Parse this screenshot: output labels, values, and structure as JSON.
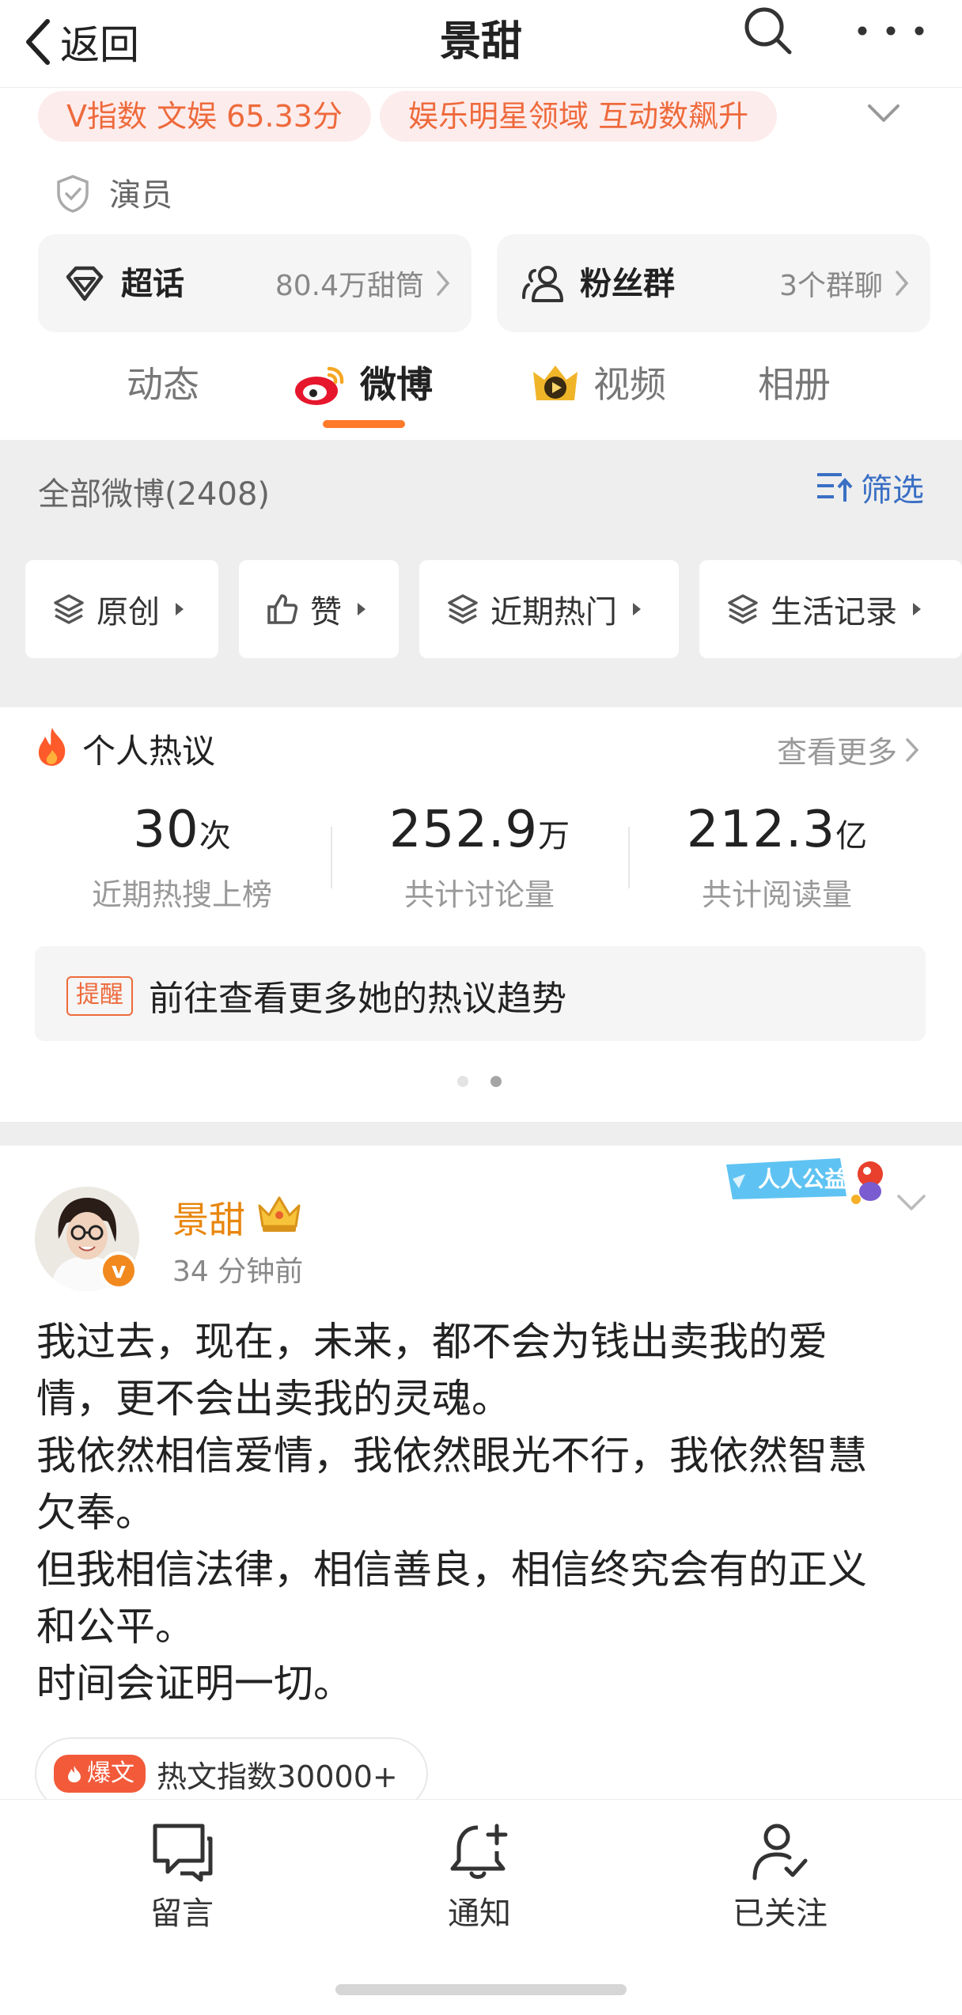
{
  "nav": {
    "back_label": "返回",
    "title": "景甜"
  },
  "profile": {
    "v_index_badge": "V指数 文娱 65.33分",
    "domain_badge": "娱乐明星领域 互动数飙升",
    "role": "演员",
    "supertopic": {
      "label": "超话",
      "value": "80.4万甜筒"
    },
    "fan_group": {
      "label": "粉丝群",
      "value": "3个群聊"
    }
  },
  "tabs": [
    "动态",
    "微博",
    "视频",
    "相册"
  ],
  "active_tab": "微博",
  "filter": {
    "all_label": "全部微博(2408)",
    "filter_label": "筛选",
    "chips": [
      "原创",
      "赞",
      "近期热门",
      "生活记录"
    ]
  },
  "hot_discussion": {
    "title": "个人热议",
    "see_more": "查看更多",
    "stats": [
      {
        "number": "30",
        "unit": "次",
        "label": "近期热搜上榜"
      },
      {
        "number": "252.9",
        "unit": "万",
        "label": "共计讨论量"
      },
      {
        "number": "212.3",
        "unit": "亿",
        "label": "共计阅读量"
      }
    ],
    "reminder_tag": "提醒",
    "reminder_text": "前往查看更多她的热议趋势"
  },
  "post": {
    "author": "景甜",
    "time": "34 分钟前",
    "charity_badge": "人人公益",
    "verified_mark": "v",
    "lines": [
      "我过去，现在，未来，都不会为钱出卖我的爱",
      "情，更不会出卖我的灵魂。",
      "我依然相信爱情，我依然眼光不行，我依然智慧",
      "欠奉。",
      "但我相信法律，相信善良，相信终究会有的正义",
      "和公平。",
      "时间会证明一切。"
    ],
    "hot_tag": "爆文",
    "hot_index": "热文指数30000+"
  },
  "bottom_bar": {
    "comment": "留言",
    "notify": "通知",
    "followed": "已关注"
  },
  "colors": {
    "accent_orange": "#ff7a2a",
    "link_blue": "#3a6fc4",
    "name_gold": "#e8860d"
  }
}
